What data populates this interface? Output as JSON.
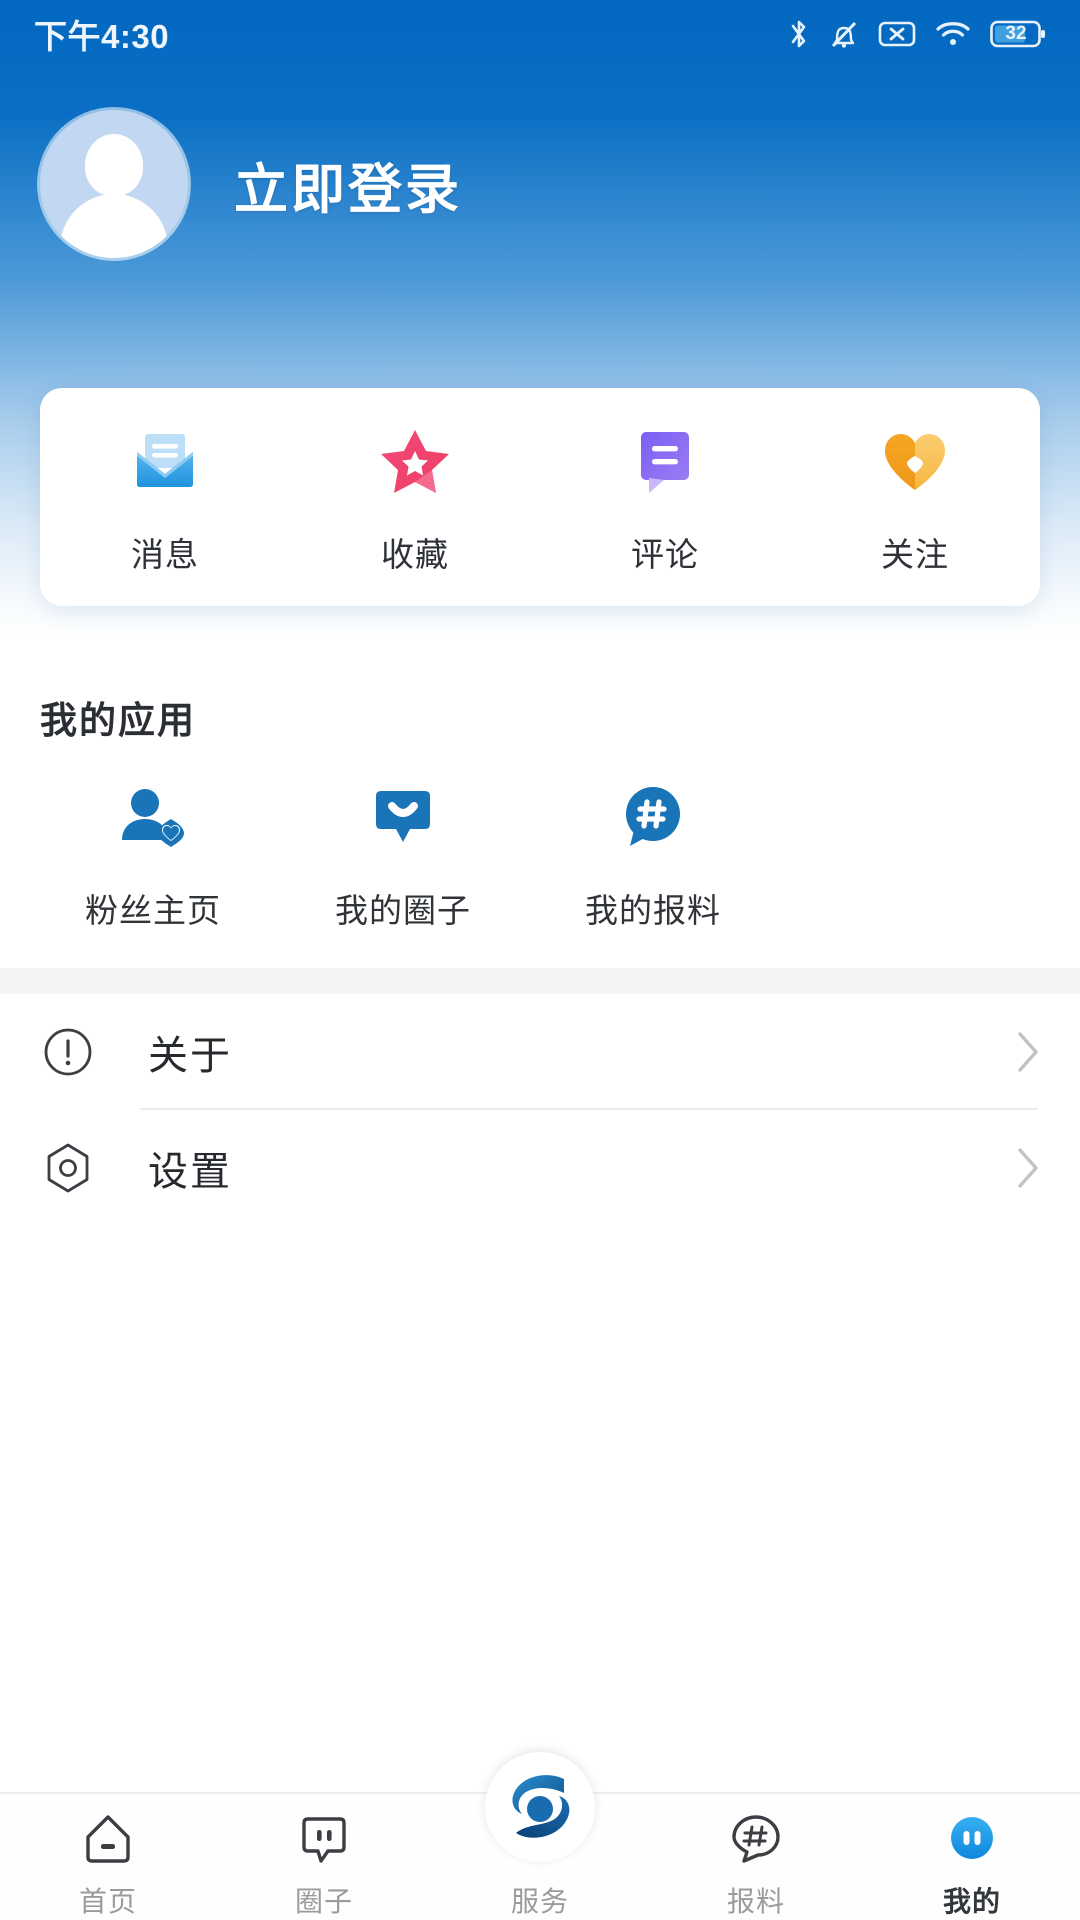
{
  "status_bar": {
    "time": "下午4:30",
    "battery_level": "32",
    "icons": [
      "bluetooth-icon",
      "bell-muted-icon",
      "sim-no-service-icon",
      "wifi-icon",
      "battery-icon"
    ]
  },
  "profile": {
    "login_label": "立即登录",
    "avatar_icon": "default-avatar-icon"
  },
  "quick_actions": [
    {
      "label": "消息",
      "icon": "envelope-icon",
      "color": "#29a0e8"
    },
    {
      "label": "收藏",
      "icon": "star-icon",
      "color": "#f0436c"
    },
    {
      "label": "评论",
      "icon": "comment-bubble-icon",
      "color": "#7b5cf0"
    },
    {
      "label": "关注",
      "icon": "heart-icon",
      "color": "#f6a821"
    }
  ],
  "my_apps": {
    "title": "我的应用",
    "items": [
      {
        "label": "粉丝主页",
        "icon": "person-heart-icon"
      },
      {
        "label": "我的圈子",
        "icon": "smile-bubble-icon"
      },
      {
        "label": "我的报料",
        "icon": "hashtag-bubble-icon"
      }
    ]
  },
  "list_rows": [
    {
      "label": "关于",
      "icon": "info-circle-icon",
      "chevron": "chevron-right-icon"
    },
    {
      "label": "设置",
      "icon": "settings-hexagon-icon",
      "chevron": "chevron-right-icon"
    }
  ],
  "bottom_nav": {
    "items": [
      {
        "label": "首页",
        "icon": "home-icon",
        "active": false
      },
      {
        "label": "圈子",
        "icon": "chat-bubble-icon",
        "active": false
      },
      {
        "label": "服务",
        "icon": "service-logo-icon",
        "active": false
      },
      {
        "label": "报料",
        "icon": "hashtag-bubble-icon",
        "active": false
      },
      {
        "label": "我的",
        "icon": "profile-face-icon",
        "active": true
      }
    ]
  },
  "colors": {
    "header_blue": "#0268c0",
    "accent_blue": "#1a7fd4",
    "active_nav": "#1fa0ef",
    "text_primary": "#26292e",
    "text_muted": "#9b9b9b"
  }
}
